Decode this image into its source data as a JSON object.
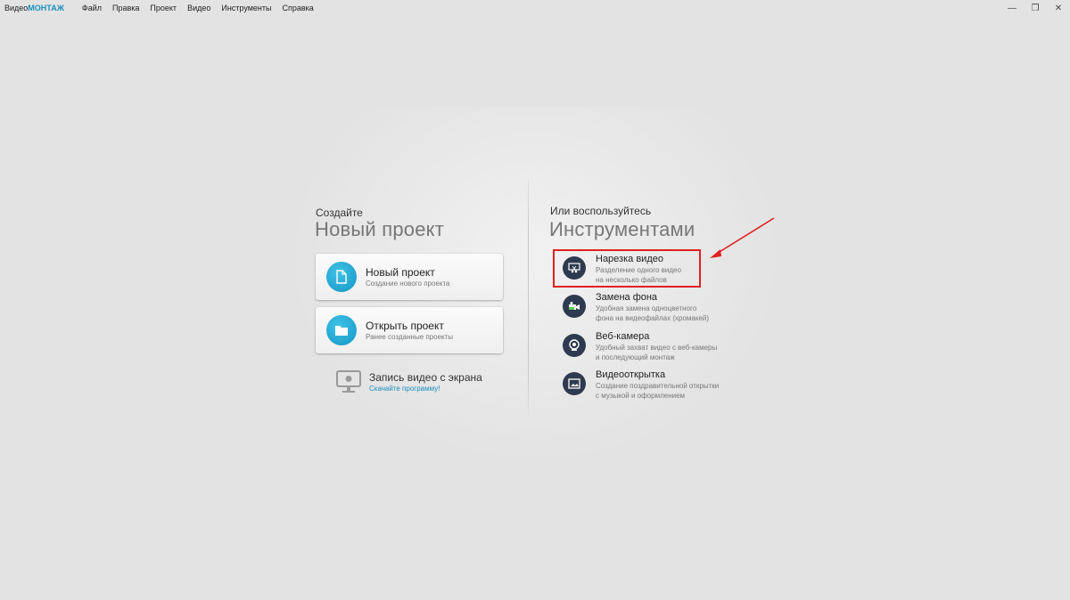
{
  "app": {
    "logo_prefix": "Видео",
    "logo_brand": "МОНТАЖ",
    "menu": [
      "Файл",
      "Правка",
      "Проект",
      "Видео",
      "Инструменты",
      "Справка"
    ],
    "window_controls": {
      "minimize": "—",
      "maximize": "❐",
      "close": "✕"
    }
  },
  "left": {
    "subtitle": "Создайте",
    "title": "Новый проект",
    "cards": [
      {
        "title": "Новый проект",
        "desc": "Создание нового проекта",
        "icon": "document-icon"
      },
      {
        "title": "Открыть проект",
        "desc": "Ранее созданные проекты",
        "icon": "folder-icon"
      }
    ],
    "screen_record": {
      "title": "Запись видео с экрана",
      "link": "Скачайте программу!",
      "icon": "monitor-icon"
    }
  },
  "right": {
    "subtitle": "Или воспользуйтесь",
    "title": "Инструментами",
    "tools": [
      {
        "title": "Нарезка видео",
        "desc1": "Разделение одного видео",
        "desc2": "на несколько файлов",
        "icon": "scissors-screen-icon"
      },
      {
        "title": "Замена фона",
        "desc1": "Удобная замена одноцветного",
        "desc2": "фона на видеофайлах (хромакей)",
        "icon": "chromakey-icon"
      },
      {
        "title": "Веб-камера",
        "desc1": "Удобный захват видео с веб-камеры",
        "desc2": "и последующий монтаж",
        "icon": "webcam-icon"
      },
      {
        "title": "Видеооткрытка",
        "desc1": "Создание поздравительной открытки",
        "desc2": "с музыкой и оформлением",
        "icon": "postcard-icon"
      }
    ]
  },
  "colors": {
    "accent": "#1a8fbf",
    "tool_circle": "#2e3a4f",
    "highlight": "#e02020",
    "background": "#e3e3e3"
  }
}
